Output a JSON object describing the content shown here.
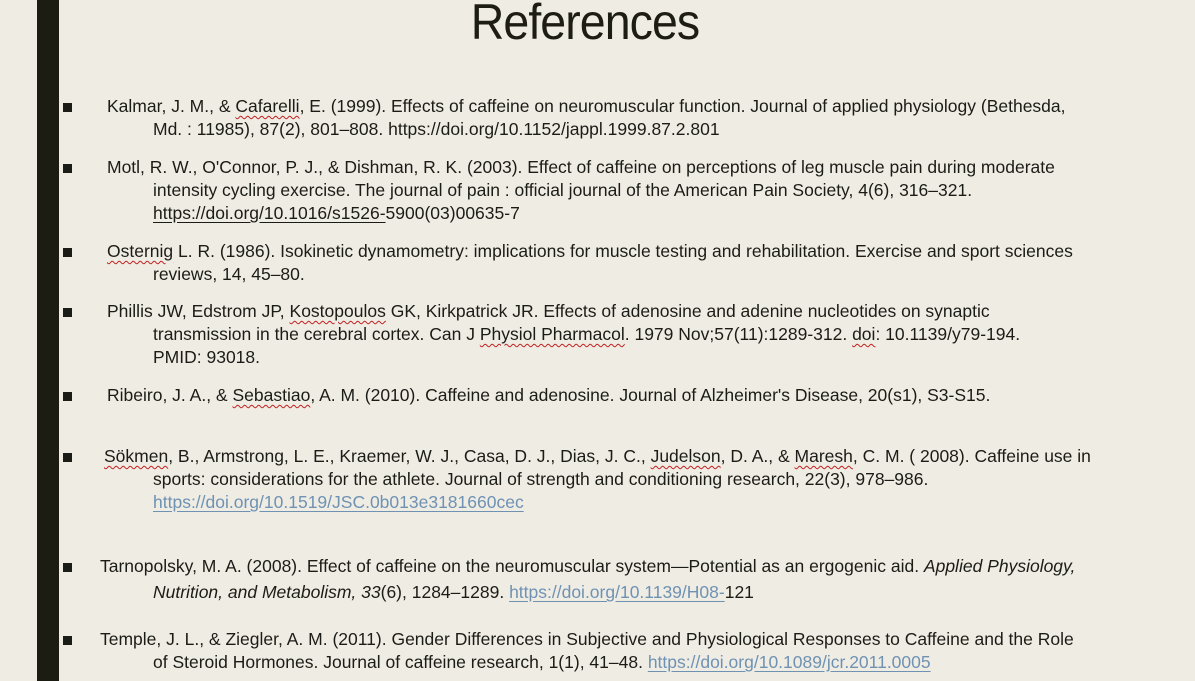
{
  "title": "References",
  "refs": [
    {
      "l1": {
        "a": "Kalmar, J. M., & ",
        "b": "Cafarelli",
        "c": ", E. (1999). Effects of caffeine on neuromuscular function. Journal of applied physiology (Bethesda,"
      },
      "l2": "Md. : 11985), 87(2), 801–808. https://doi.org/10.1152/jappl.1999.87.2.801"
    },
    {
      "l1": "Motl, R. W., O'Connor, P. J., & Dishman, R. K. (2003). Effect of caffeine on perceptions of leg muscle pain during moderate",
      "l2": "intensity cycling exercise. The journal of pain : official journal of the American Pain Society, 4(6), 316–321.",
      "l3": {
        "a": "https://doi.org/10.1016/s1526-",
        "b": "5900(03)00635-7"
      }
    },
    {
      "l1": {
        "a": "Osternig",
        "b": " L. R. (1986). Isokinetic dynamometry: implications for muscle testing and rehabilitation. Exercise and sport sciences"
      },
      "l2": "reviews, 14, 45–80."
    },
    {
      "l1": {
        "a": "Phillis JW, Edstrom JP, ",
        "b": "Kostopoulos",
        "c": " GK, Kirkpatrick JR. Effects of adenosine and adenine nucleotides on synaptic"
      },
      "l2": {
        "a": "transmission in the cerebral cortex. Can J ",
        "b": "Physiol Pharmacol",
        "c": ". 1979 Nov;57(11):1289-312. ",
        "d": "doi",
        "e": ": 10.1139/y79-194."
      },
      "l3": "PMID: 93018."
    },
    {
      "l1": {
        "a": "Ribeiro, J. A., & ",
        "b": "Sebastiao",
        "c": ", A. M. (2010). Caffeine and adenosine. Journal of Alzheimer's Disease, 20(s1), S3-S15."
      }
    },
    {
      "l1": {
        "a": "Sökmen",
        "b": ", B., Armstrong, L. E., Kraemer, W. J., Casa, D. J., Dias, J. C., ",
        "c": "Judelson",
        "d": ", D. A., & ",
        "e": "Maresh",
        "f": ", C. M. (  2008). Caffeine use in"
      },
      "l2": "sports: considerations for the athlete. Journal of strength and conditioning research, 22(3), 978–986.",
      "l3": "https://doi.org/10.1519/JSC.0b013e3181660cec"
    },
    {
      "l1": {
        "a": "Tarnopolsky, M. A. (2008). Effect of caffeine on the neuromuscular system—Potential as an ergogenic aid. ",
        "b": "Applied Physiology,"
      },
      "l2": {
        "a": "Nutrition, and Metabolism",
        "b": ", ",
        "c": "33",
        "d": "(6), 1284–1289. ",
        "e": "https://doi.org/10.1139/H08-",
        "f": "121"
      }
    },
    {
      "l1": "Temple, J. L., & Ziegler, A. M. (2011). Gender Differences in Subjective and Physiological Responses to Caffeine and the Role",
      "l2": {
        "a": "of Steroid Hormones. Journal of caffeine research, 1(1), 41–48. ",
        "b": "https://doi.org/10.1089/jcr.2011.0005"
      }
    }
  ]
}
